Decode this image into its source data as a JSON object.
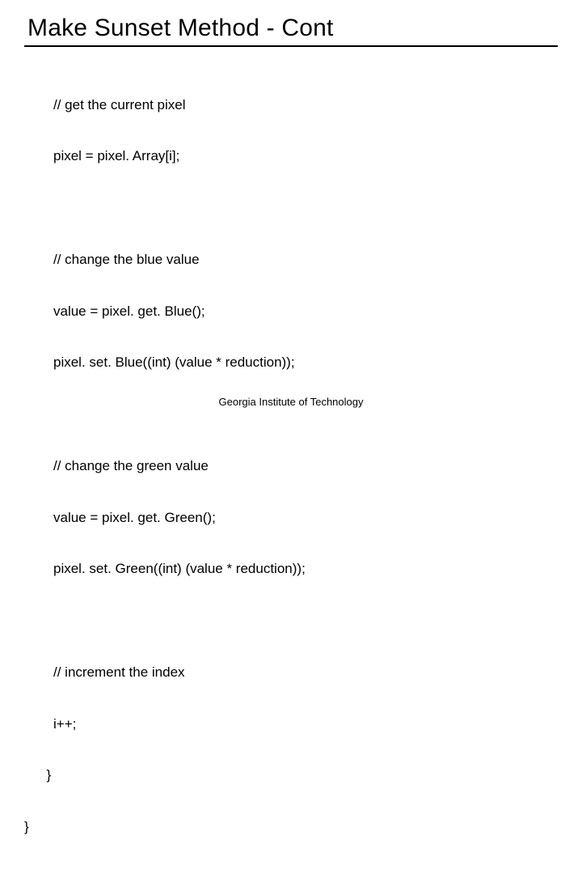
{
  "title": "Make Sunset Method - Cont",
  "code": {
    "c1": "// get the current pixel",
    "l1": "pixel = pixel. Array[i];",
    "c2": "// change the blue value",
    "l2": "value = pixel. get. Blue();",
    "l3": "pixel. set. Blue((int) (value * reduction));",
    "c3": "// change the green value",
    "l4": "value = pixel. get. Green();",
    "l5": "pixel. set. Green((int) (value * reduction));",
    "c4": "// increment the index",
    "l6": "i++;",
    "b1": "  }",
    "b2": "}"
  },
  "footer": "Georgia Institute of Technology"
}
